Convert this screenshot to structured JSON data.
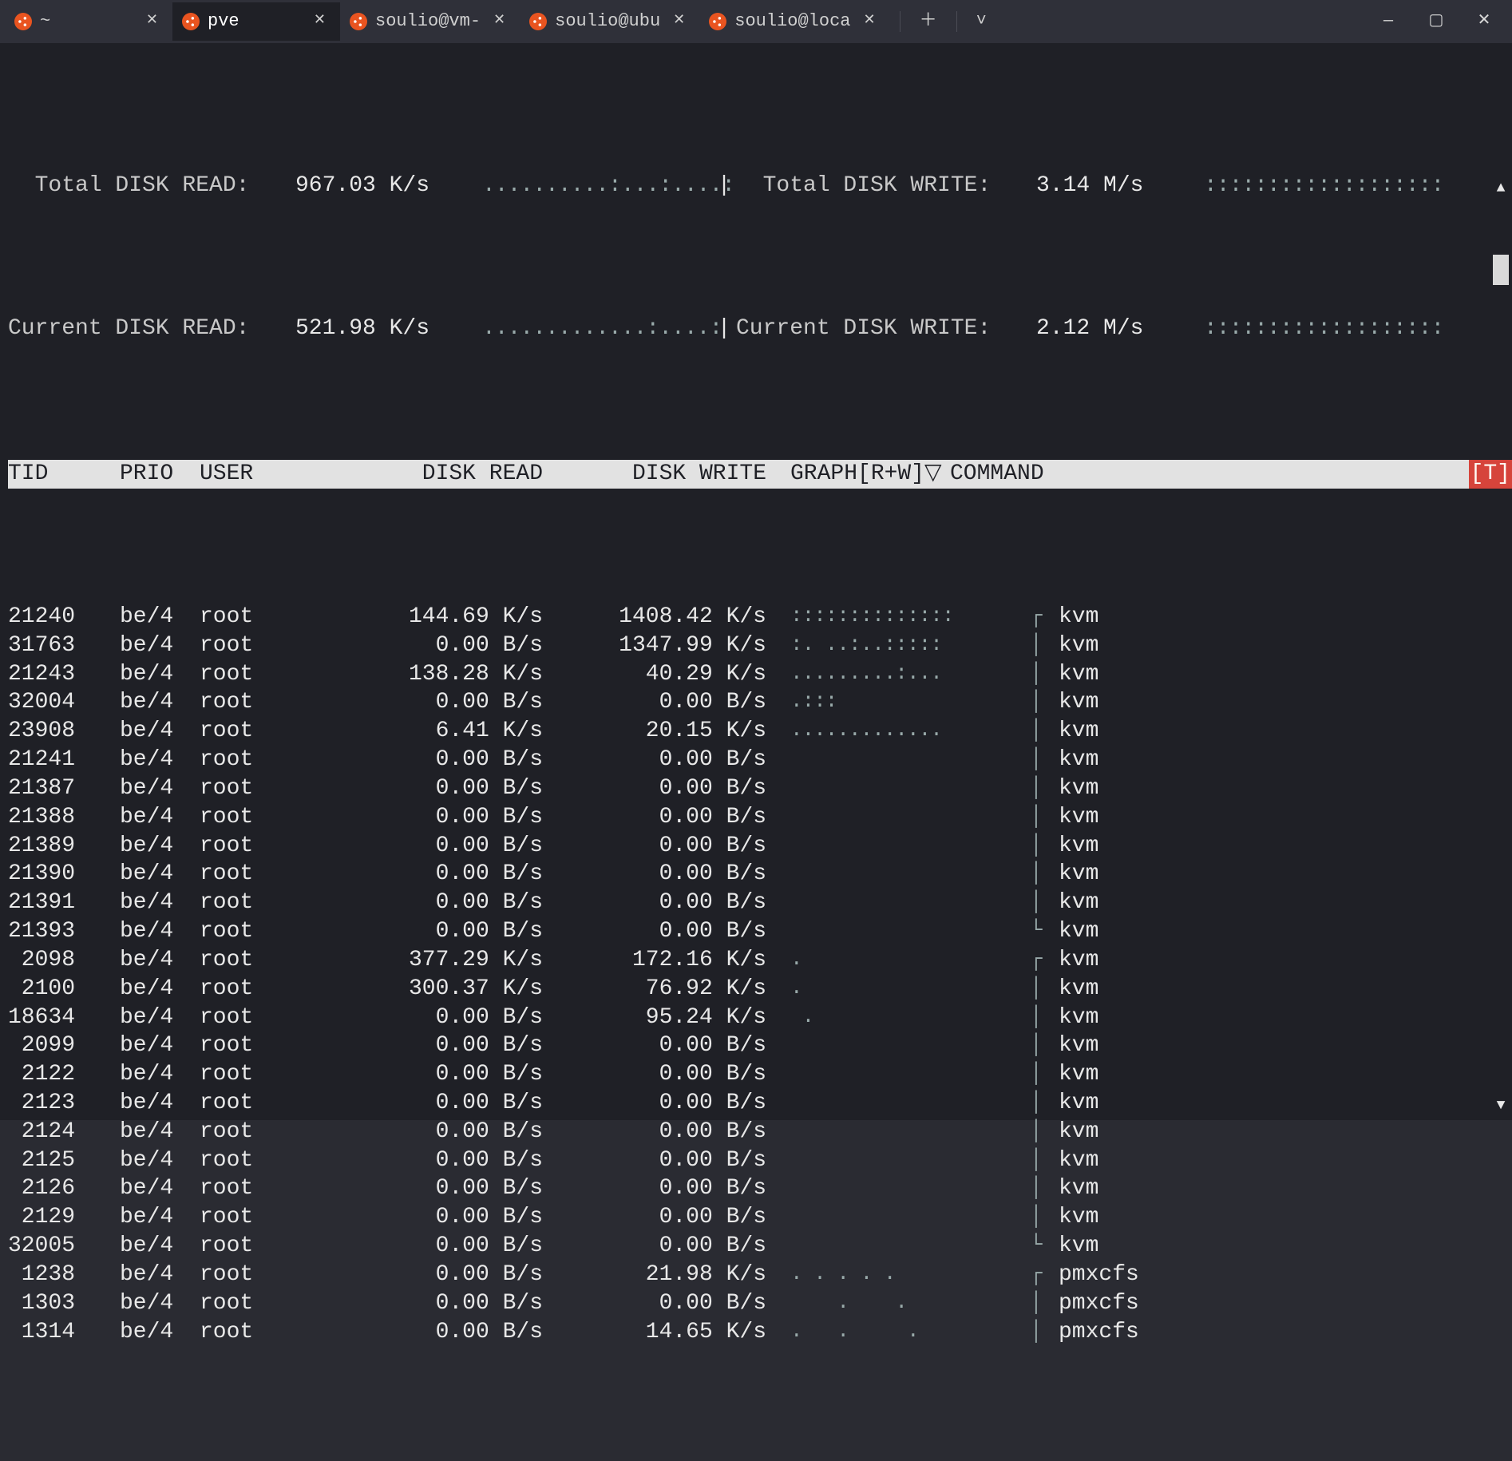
{
  "tabs": [
    {
      "label": "~",
      "active": false
    },
    {
      "label": "pve",
      "active": true
    },
    {
      "label": "soulio@vm-",
      "active": false
    },
    {
      "label": "soulio@ubu",
      "active": false
    },
    {
      "label": "soulio@loca",
      "active": false
    }
  ],
  "summary": {
    "total_read_label": "  Total DISK READ:",
    "total_read_value": "967.03 K/s",
    "total_read_graph": "..........:...:....:",
    "total_write_label": "  Total DISK WRITE:",
    "total_write_value": "3.14 M/s",
    "total_write_graph": ":::::::::::::::::::",
    "current_read_label": "Current DISK READ:",
    "current_read_value": "521.98 K/s",
    "current_read_graph": ".............:....:",
    "current_write_label": "Current DISK WRITE:",
    "current_write_value": "2.12 M/s",
    "current_write_graph": ":::::::::::::::::::",
    "pipe": "|"
  },
  "header": {
    "tid": "TID",
    "prio": "PRIO",
    "user": "USER",
    "read": "DISK READ",
    "write": "DISK WRITE",
    "graph": "GRAPH[R+W]▽",
    "cmd": "COMMAND",
    "tag": "[T]"
  },
  "rows": [
    {
      "tid": "21240",
      "prio": "be/4",
      "user": "root",
      "read": "144.69 K/s",
      "write": "1408.42 K/s",
      "graph": "::::::::::::::",
      "tree": "┌",
      "cmd": "kvm"
    },
    {
      "tid": "31763",
      "prio": "be/4",
      "user": "root",
      "read": "0.00 B/s",
      "write": "1347.99 K/s",
      "graph": ":. ..:..:::::",
      "tree": "│",
      "cmd": "kvm"
    },
    {
      "tid": "21243",
      "prio": "be/4",
      "user": "root",
      "read": "138.28 K/s",
      "write": "40.29 K/s",
      "graph": ".........:...",
      "tree": "│",
      "cmd": "kvm"
    },
    {
      "tid": "32004",
      "prio": "be/4",
      "user": "root",
      "read": "0.00 B/s",
      "write": "0.00 B/s",
      "graph": ".:::",
      "tree": "│",
      "cmd": "kvm"
    },
    {
      "tid": "23908",
      "prio": "be/4",
      "user": "root",
      "read": "6.41 K/s",
      "write": "20.15 K/s",
      "graph": ".............",
      "tree": "│",
      "cmd": "kvm"
    },
    {
      "tid": "21241",
      "prio": "be/4",
      "user": "root",
      "read": "0.00 B/s",
      "write": "0.00 B/s",
      "graph": "",
      "tree": "│",
      "cmd": "kvm"
    },
    {
      "tid": "21387",
      "prio": "be/4",
      "user": "root",
      "read": "0.00 B/s",
      "write": "0.00 B/s",
      "graph": "",
      "tree": "│",
      "cmd": "kvm"
    },
    {
      "tid": "21388",
      "prio": "be/4",
      "user": "root",
      "read": "0.00 B/s",
      "write": "0.00 B/s",
      "graph": "",
      "tree": "│",
      "cmd": "kvm"
    },
    {
      "tid": "21389",
      "prio": "be/4",
      "user": "root",
      "read": "0.00 B/s",
      "write": "0.00 B/s",
      "graph": "",
      "tree": "│",
      "cmd": "kvm"
    },
    {
      "tid": "21390",
      "prio": "be/4",
      "user": "root",
      "read": "0.00 B/s",
      "write": "0.00 B/s",
      "graph": "",
      "tree": "│",
      "cmd": "kvm"
    },
    {
      "tid": "21391",
      "prio": "be/4",
      "user": "root",
      "read": "0.00 B/s",
      "write": "0.00 B/s",
      "graph": "",
      "tree": "│",
      "cmd": "kvm"
    },
    {
      "tid": "21393",
      "prio": "be/4",
      "user": "root",
      "read": "0.00 B/s",
      "write": "0.00 B/s",
      "graph": "",
      "tree": "└",
      "cmd": "kvm"
    },
    {
      "tid": "2098",
      "prio": "be/4",
      "user": "root",
      "read": "377.29 K/s",
      "write": "172.16 K/s",
      "graph": ".",
      "tree": "┌",
      "cmd": "kvm"
    },
    {
      "tid": "2100",
      "prio": "be/4",
      "user": "root",
      "read": "300.37 K/s",
      "write": "76.92 K/s",
      "graph": ".",
      "tree": "│",
      "cmd": "kvm"
    },
    {
      "tid": "18634",
      "prio": "be/4",
      "user": "root",
      "read": "0.00 B/s",
      "write": "95.24 K/s",
      "graph": " .",
      "tree": "│",
      "cmd": "kvm"
    },
    {
      "tid": "2099",
      "prio": "be/4",
      "user": "root",
      "read": "0.00 B/s",
      "write": "0.00 B/s",
      "graph": "",
      "tree": "│",
      "cmd": "kvm"
    },
    {
      "tid": "2122",
      "prio": "be/4",
      "user": "root",
      "read": "0.00 B/s",
      "write": "0.00 B/s",
      "graph": "",
      "tree": "│",
      "cmd": "kvm"
    },
    {
      "tid": "2123",
      "prio": "be/4",
      "user": "root",
      "read": "0.00 B/s",
      "write": "0.00 B/s",
      "graph": "",
      "tree": "│",
      "cmd": "kvm"
    },
    {
      "tid": "2124",
      "prio": "be/4",
      "user": "root",
      "read": "0.00 B/s",
      "write": "0.00 B/s",
      "graph": "",
      "tree": "│",
      "cmd": "kvm"
    },
    {
      "tid": "2125",
      "prio": "be/4",
      "user": "root",
      "read": "0.00 B/s",
      "write": "0.00 B/s",
      "graph": "",
      "tree": "│",
      "cmd": "kvm"
    },
    {
      "tid": "2126",
      "prio": "be/4",
      "user": "root",
      "read": "0.00 B/s",
      "write": "0.00 B/s",
      "graph": "",
      "tree": "│",
      "cmd": "kvm"
    },
    {
      "tid": "2129",
      "prio": "be/4",
      "user": "root",
      "read": "0.00 B/s",
      "write": "0.00 B/s",
      "graph": "",
      "tree": "│",
      "cmd": "kvm"
    },
    {
      "tid": "32005",
      "prio": "be/4",
      "user": "root",
      "read": "0.00 B/s",
      "write": "0.00 B/s",
      "graph": "",
      "tree": "└",
      "cmd": "kvm"
    },
    {
      "tid": "1238",
      "prio": "be/4",
      "user": "root",
      "read": "0.00 B/s",
      "write": "21.98 K/s",
      "graph": ". . . . .",
      "tree": "┌",
      "cmd": "pmxcfs"
    },
    {
      "tid": "1303",
      "prio": "be/4",
      "user": "root",
      "read": "0.00 B/s",
      "write": "0.00 B/s",
      "graph": "    .    .",
      "tree": "│",
      "cmd": "pmxcfs"
    },
    {
      "tid": "1314",
      "prio": "be/4",
      "user": "root",
      "read": "0.00 B/s",
      "write": "14.65 K/s",
      "graph": ".   .     .",
      "tree": "│",
      "cmd": "pmxcfs"
    }
  ]
}
